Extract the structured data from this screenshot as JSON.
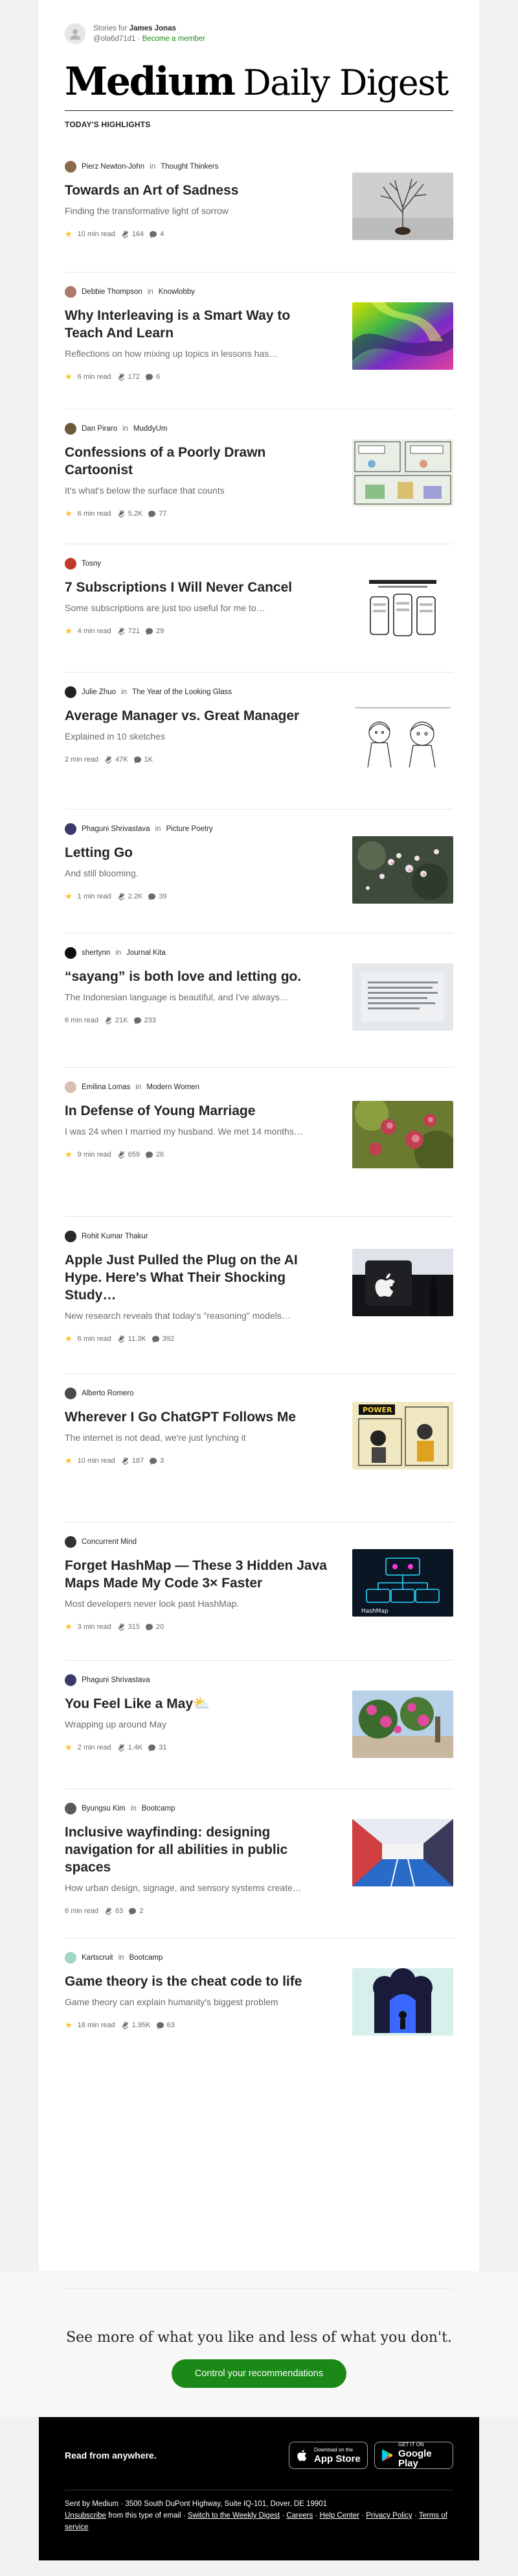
{
  "header": {
    "stories_for_prefix": "Stories for",
    "user_name": "James Jonas",
    "handle": "@ola6d71d1",
    "separator": "·",
    "become_member": "Become a member",
    "logo_bold": "Medium",
    "logo_light": "Daily Digest",
    "section_title": "TODAY'S HIGHLIGHTS"
  },
  "stories": [
    {
      "author": "Pierz Newton-John",
      "in": "in",
      "publication": "Thought Thinkers",
      "title": "Towards an Art of Sadness",
      "subtitle": "Finding the transformative light of sorrow",
      "member_only": true,
      "read_time": "10 min read",
      "claps": "164",
      "responses": "4",
      "avatar_color": "#8a6a4a",
      "thumb": "tree"
    },
    {
      "author": "Debbie Thompson",
      "in": "in",
      "publication": "Knowlobby",
      "title": "Why Interleaving is a Smart Way to Teach And Learn",
      "subtitle": "Reflections on how mixing up topics in lessons has…",
      "member_only": true,
      "read_time": "6 min read",
      "claps": "172",
      "responses": "6",
      "avatar_color": "#b07a6a",
      "thumb": "swirl"
    },
    {
      "author": "Dan Piraro",
      "in": "in",
      "publication": "MuddyUm",
      "title": "Confessions of a Poorly Drawn Cartoonist",
      "subtitle": "It's what's below the surface that counts",
      "member_only": true,
      "read_time": "6 min read",
      "claps": "5.2K",
      "responses": "77",
      "avatar_color": "#6a5a3a",
      "thumb": "cartoon"
    },
    {
      "author": "Tosny",
      "in": "",
      "publication": "",
      "title": "7 Subscriptions I Will Never Cancel",
      "subtitle": "Some subscriptions are just too useful for me to…",
      "member_only": true,
      "read_time": "4 min read",
      "claps": "721",
      "responses": "29",
      "avatar_color": "#c0392b",
      "thumb": "phones"
    },
    {
      "author": "Julie Zhuo",
      "in": "in",
      "publication": "The Year of the Looking Glass",
      "title": "Average Manager vs. Great Manager",
      "subtitle": "Explained in 10 sketches",
      "member_only": false,
      "read_time": "2 min read",
      "claps": "47K",
      "responses": "1K",
      "avatar_color": "#222222",
      "thumb": "sketch"
    },
    {
      "author": "Phaguni Shrivastava",
      "in": "in",
      "publication": "Picture Poetry",
      "title": "Letting Go",
      "subtitle": "And still blooming.",
      "member_only": true,
      "read_time": "1 min read",
      "claps": "2.2K",
      "responses": "39",
      "avatar_color": "#3a3a6a",
      "thumb": "blossom"
    },
    {
      "author": "shertynn",
      "in": "in",
      "publication": "Journal Kita",
      "title": "“sayang” is both love and letting go.",
      "subtitle": "The Indonesian language is beautiful, and I've always…",
      "member_only": false,
      "read_time": "6 min read",
      "claps": "21K",
      "responses": "233",
      "avatar_color": "#111111",
      "thumb": "textcard"
    },
    {
      "author": "Emilina Lomas",
      "in": "in",
      "publication": "Modern Women",
      "title": "In Defense of Young Marriage",
      "subtitle": "I was 24 when I married my husband. We met 14 months…",
      "member_only": true,
      "read_time": "9 min read",
      "claps": "659",
      "responses": "26",
      "avatar_color": "#d8c0b0",
      "thumb": "flowers"
    },
    {
      "author": "Rohit Kumar Thakur",
      "in": "",
      "publication": "",
      "title": "Apple Just Pulled the Plug on the AI Hype. Here's What Their Shocking Study…",
      "subtitle": "New research reveals that today's \"reasoning\" models…",
      "member_only": true,
      "read_time": "6 min read",
      "claps": "11.3K",
      "responses": "392",
      "avatar_color": "#2a2a2a",
      "thumb": "apple"
    },
    {
      "author": "Alberto Romero",
      "in": "",
      "publication": "",
      "title": "Wherever I Go ChatGPT Follows Me",
      "subtitle": "The internet is not dead, we're just lynching it",
      "member_only": true,
      "read_time": "10 min read",
      "claps": "187",
      "responses": "3",
      "avatar_color": "#4a4a4a",
      "thumb": "comic"
    },
    {
      "author": "Concurrent Mind",
      "in": "",
      "publication": "",
      "title": "Forget HashMap — These 3 Hidden Java Maps Made My Code 3× Faster",
      "subtitle": "Most developers never look past HashMap.",
      "member_only": true,
      "read_time": "3 min read",
      "claps": "315",
      "responses": "20",
      "avatar_color": "#333333",
      "thumb": "hashmap"
    },
    {
      "author": "Phaguni Shrivastava",
      "in": "",
      "publication": "",
      "title": "You Feel Like a May⛅",
      "subtitle": "Wrapping up around May",
      "member_only": true,
      "read_time": "2 min read",
      "claps": "1.4K",
      "responses": "31",
      "avatar_color": "#3a3a6a",
      "thumb": "bougain"
    },
    {
      "author": "Byungsu Kim",
      "in": "in",
      "publication": "Bootcamp",
      "title": "Inclusive wayfinding: designing navigation for all abilities in public spaces",
      "subtitle": "How urban design, signage, and sensory systems create…",
      "member_only": false,
      "read_time": "6 min read",
      "claps": "63",
      "responses": "2",
      "avatar_color": "#5a5a5a",
      "thumb": "corridor"
    },
    {
      "author": "Kartscruit",
      "in": "in",
      "publication": "Bootcamp",
      "title": "Game theory is the cheat code to life",
      "subtitle": "Game theory can explain humanity's biggest problem",
      "member_only": true,
      "read_time": "18 min read",
      "claps": "1.95K",
      "responses": "63",
      "avatar_color": "#a0d8c8",
      "thumb": "portal"
    }
  ],
  "see_more": {
    "heading": "See more of what you like and less of what you don't.",
    "button": "Control your recommendations"
  },
  "footer": {
    "read_from_anywhere": "Read from anywhere.",
    "app_store_small": "Download on the",
    "app_store_big": "App Store",
    "google_play_small": "GET IT ON",
    "google_play_big": "Google Play",
    "sent_by": "Sent by Medium · 3500 South DuPont Highway, Suite IQ-101, Dover, DE 19901",
    "unsubscribe": "Unsubscribe",
    "unsubscribe_suffix": "from this type of email ·",
    "switch": "Switch to the Weekly Digest",
    "dot": "·",
    "careers": "Careers",
    "help": "Help Center",
    "privacy": "Privacy Policy",
    "terms": "Terms of service"
  },
  "colors": {
    "accent_green": "#1a8917",
    "member_star": "#ffc017"
  }
}
